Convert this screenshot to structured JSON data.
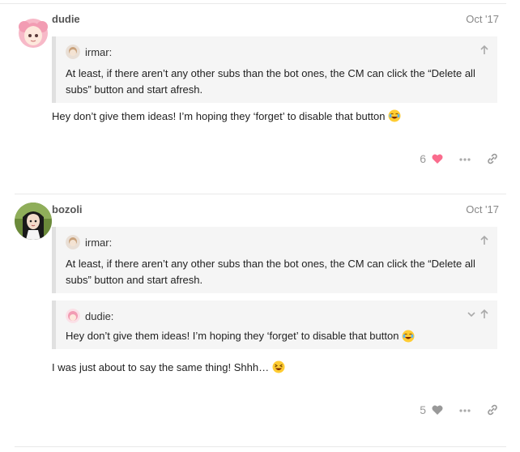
{
  "posts": [
    {
      "username": "dudie",
      "date": "Oct '17",
      "quotes": [
        {
          "author": "irmar:",
          "text": "At least, if there aren’t any other subs than the bot ones, the CM can click the “Delete all subs” button and start afresh."
        }
      ],
      "body": "Hey don’t give them ideas! I’m hoping they ‘forget’ to disable that button",
      "body_emoji": "joy-emoji",
      "like_count": "6",
      "liked": true
    },
    {
      "username": "bozoli",
      "date": "Oct '17",
      "quotes": [
        {
          "author": "irmar:",
          "text": "At least, if there aren’t any other subs than the bot ones, the CM can click the “Delete all subs” button and start afresh."
        },
        {
          "author": "dudie:",
          "text": "Hey don’t give them ideas! I’m hoping they ‘forget’ to disable that button"
        }
      ],
      "body": "I was just about to say the same thing! Shhh…",
      "body_emoji": "laughing-emoji",
      "like_count": "5",
      "liked": false
    }
  ],
  "colors": {
    "like_active": "#fa6c8d",
    "like_inactive": "#999999",
    "quote_bg": "#f5f5f5",
    "quote_border": "#e0e0e0"
  }
}
